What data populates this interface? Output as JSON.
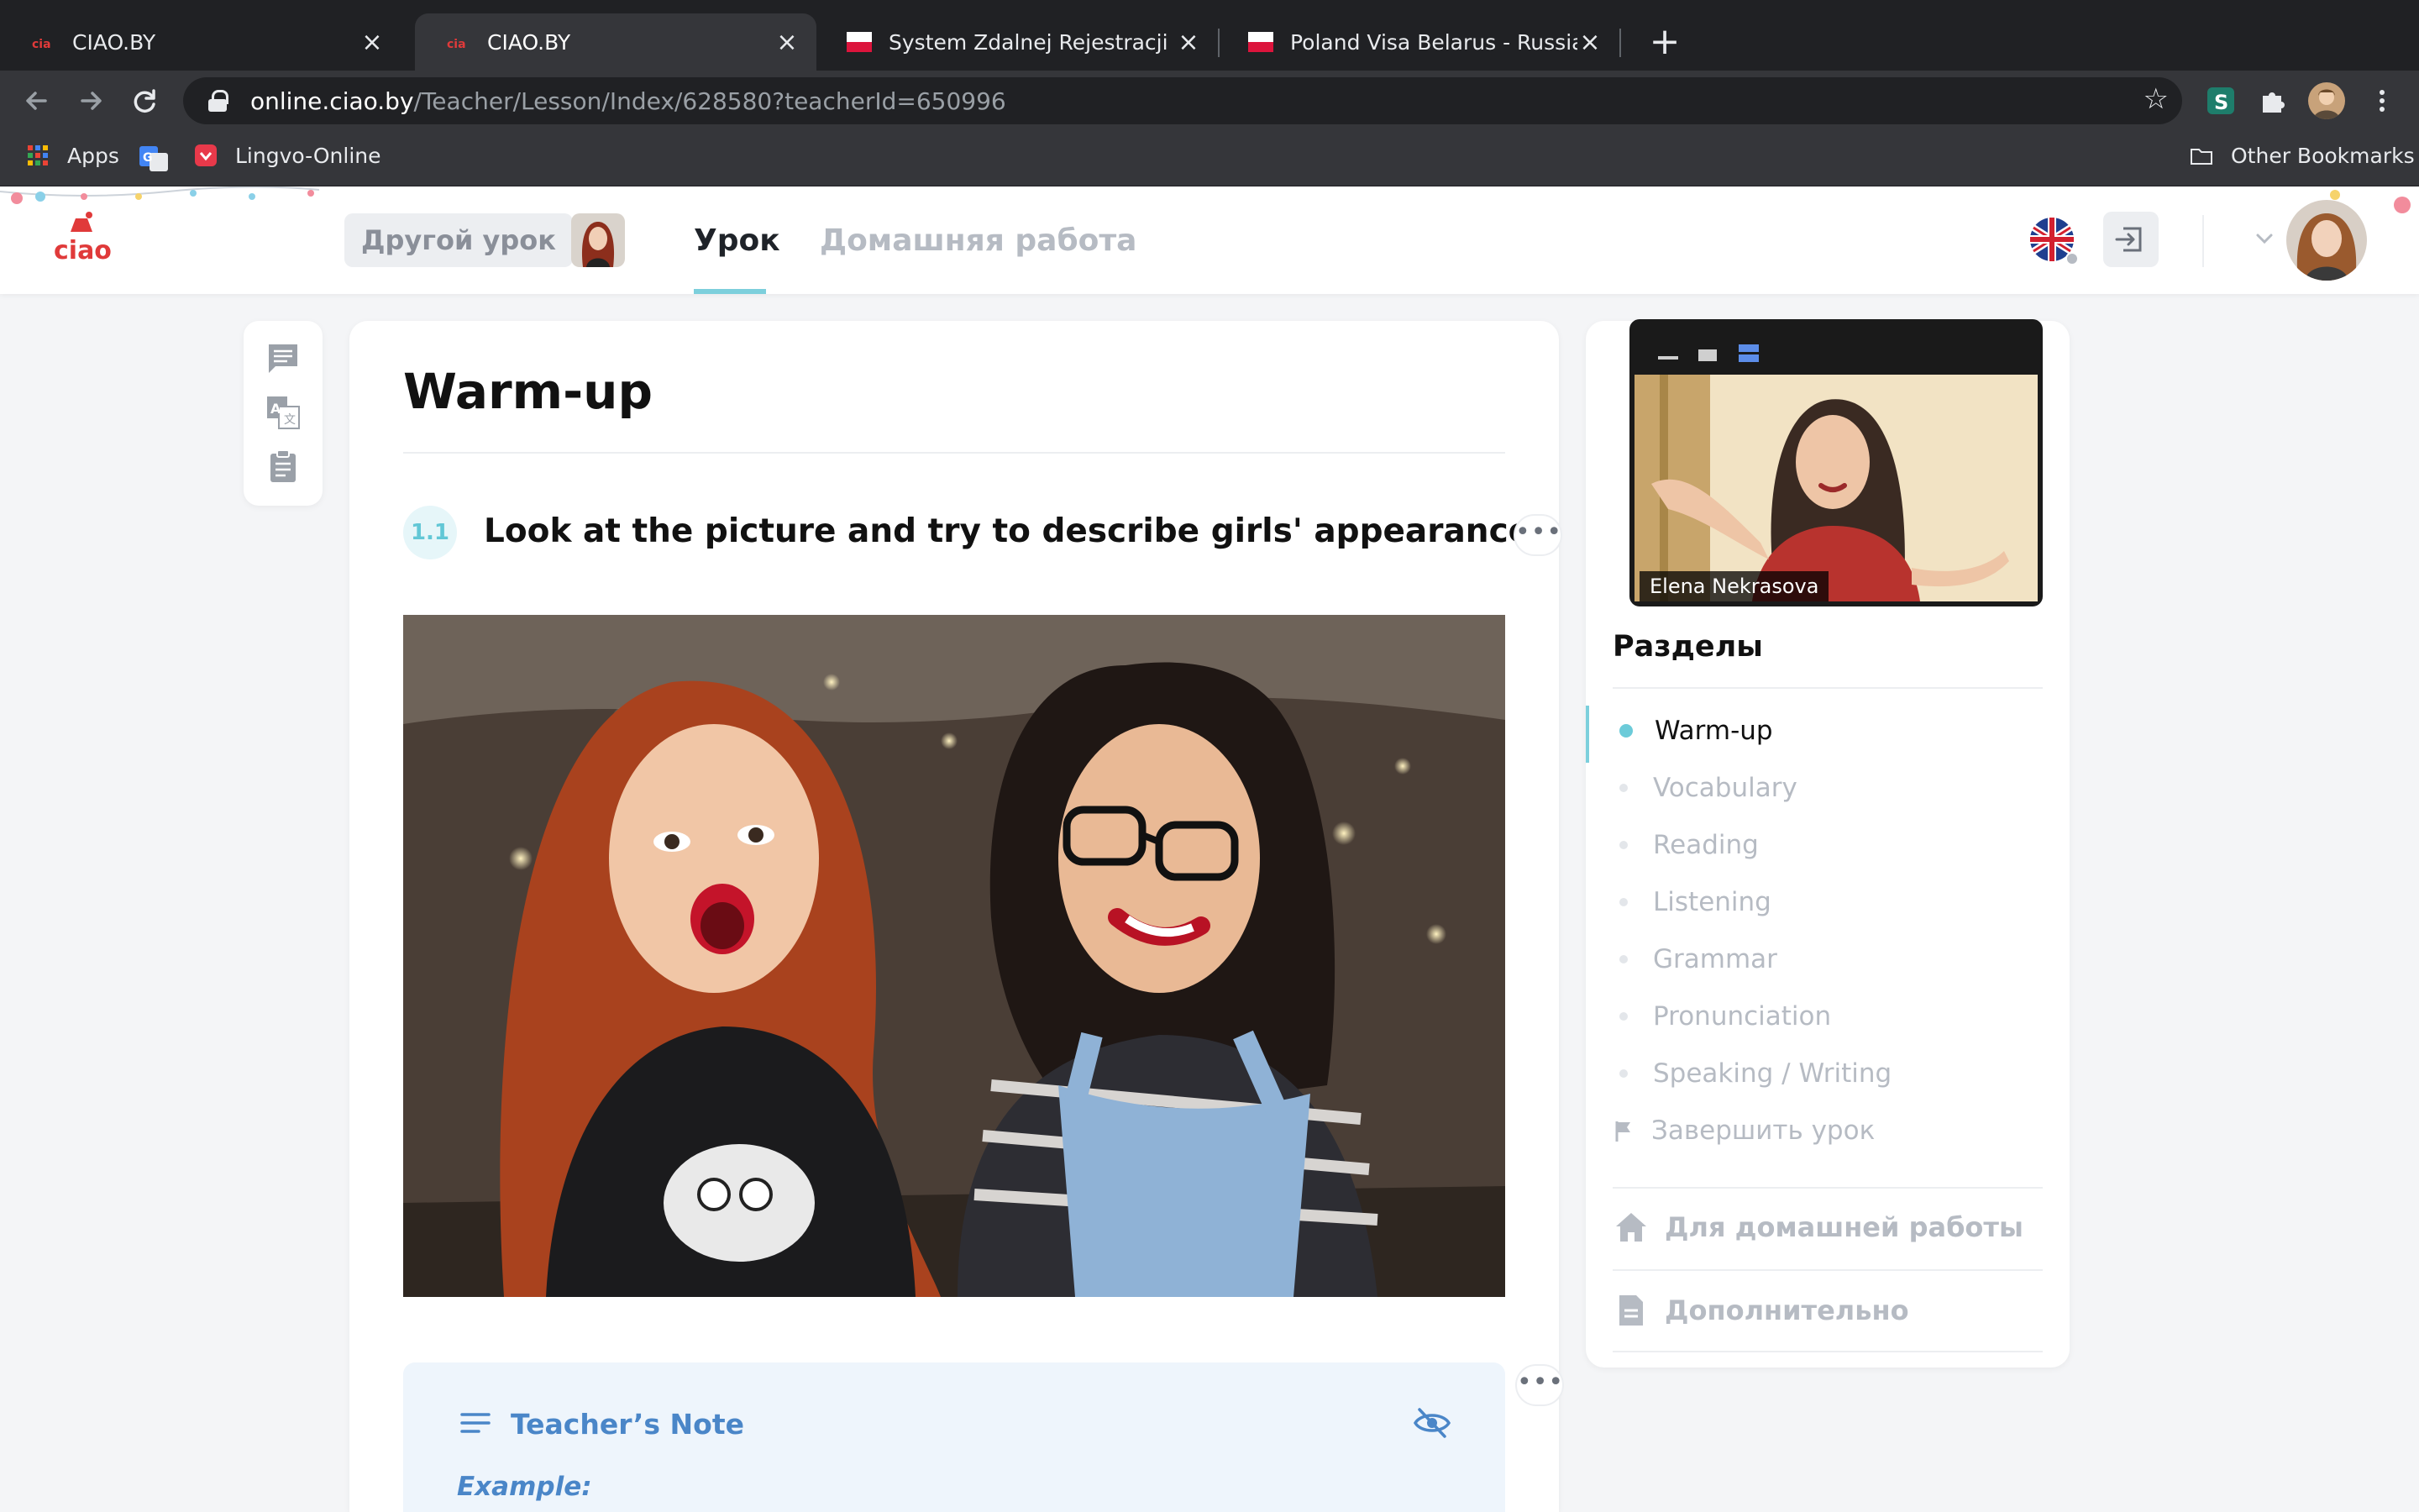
{
  "browser": {
    "tabs": [
      {
        "title": "CIAO.BY",
        "active": false,
        "icon": "ciao-favicon"
      },
      {
        "title": "CIAO.BY",
        "active": true,
        "icon": "ciao-favicon"
      },
      {
        "title": "System Zdalnej Rejestracji",
        "active": false,
        "icon": "poland-flag-favicon"
      },
      {
        "title": "Poland Visa Belarus - Russian",
        "active": false,
        "icon": "poland-flag-favicon"
      }
    ],
    "new_tab_label": "+",
    "url_host": "online.ciao.by",
    "url_path": "/Teacher/Lesson/Index/628580?teacherId=650996",
    "bookmarks": [
      "Apps",
      "Lingvo-Online"
    ],
    "other_bookmarks": "Other Bookmarks"
  },
  "header": {
    "other_lesson": "Другой урок",
    "nav": {
      "lesson": "Урок",
      "homework": "Домашняя работа"
    },
    "logo_text": "ciao",
    "language_flag": "uk-flag-icon"
  },
  "lesson": {
    "section_title": "Warm-up",
    "task": {
      "number": "1.1",
      "text": "Look at the picture and try to describe girls' appearance."
    },
    "more_label": "•••",
    "teacher_note": {
      "title": "Teacher’s Note",
      "example_label": "Example:"
    }
  },
  "video": {
    "participant_name": "Elena Nekrasova"
  },
  "sidebar": {
    "title": "Разделы",
    "sections": [
      {
        "label": "Warm-up",
        "active": true
      },
      {
        "label": "Vocabulary",
        "active": false
      },
      {
        "label": "Reading",
        "active": false
      },
      {
        "label": "Listening",
        "active": false
      },
      {
        "label": "Grammar",
        "active": false
      },
      {
        "label": "Pronunciation",
        "active": false
      },
      {
        "label": "Speaking / Writing",
        "active": false
      }
    ],
    "finish": "Завершить урок",
    "homework_link": "Для домашней работы",
    "extra_link": "Дополнительно"
  },
  "colors": {
    "accent": "#7ccfdc",
    "note_blue": "#4a86c8",
    "ciao_red": "#e03a3a",
    "chrome_dark": "#202124"
  }
}
